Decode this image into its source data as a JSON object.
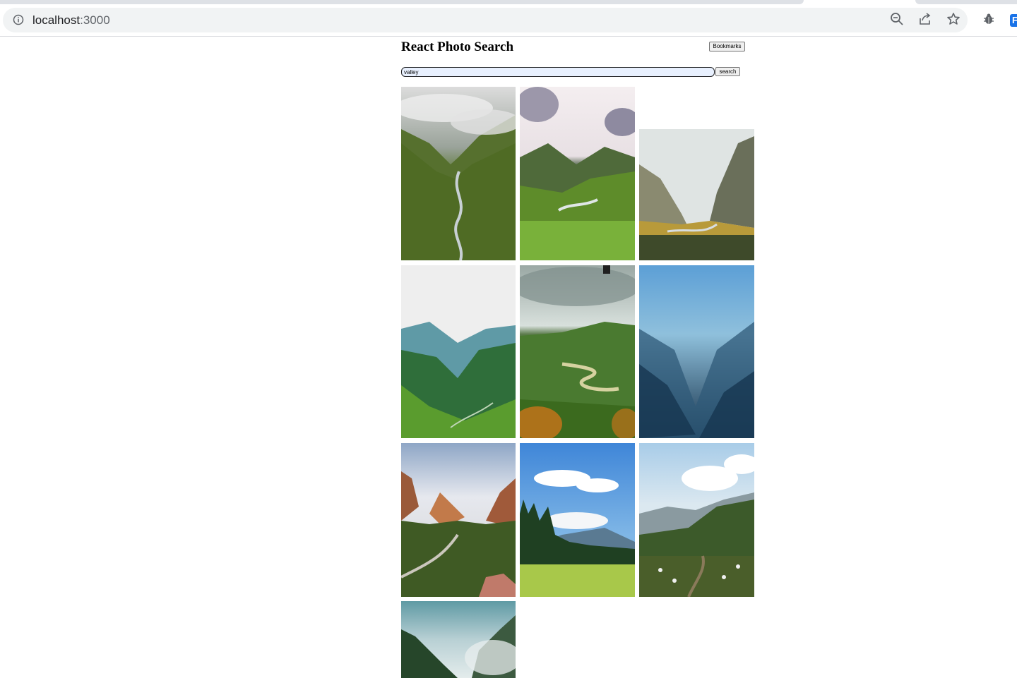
{
  "browser": {
    "url_host": "localhost",
    "url_port": ":3000",
    "extension_label": "F"
  },
  "app": {
    "title": "React Photo Search",
    "bookmarks_label": "Bookmarks",
    "search": {
      "value": "valley",
      "button_label": "search"
    }
  },
  "photos": [
    {
      "subject": "valley-river-clouds"
    },
    {
      "subject": "valley-sunlit-peaks"
    },
    {
      "subject": "valley-canyon-misty"
    },
    {
      "subject": "valley-green-mountains"
    },
    {
      "subject": "valley-winding-river"
    },
    {
      "subject": "valley-blue-fog"
    },
    {
      "subject": "valley-canyon-road"
    },
    {
      "subject": "valley-meadow-forest"
    },
    {
      "subject": "valley-trail-wildflowers"
    },
    {
      "subject": "valley-foggy-cliffs"
    }
  ],
  "colors": {
    "input_background": "#e8f0fe",
    "omnibox": "#f1f3f4"
  }
}
